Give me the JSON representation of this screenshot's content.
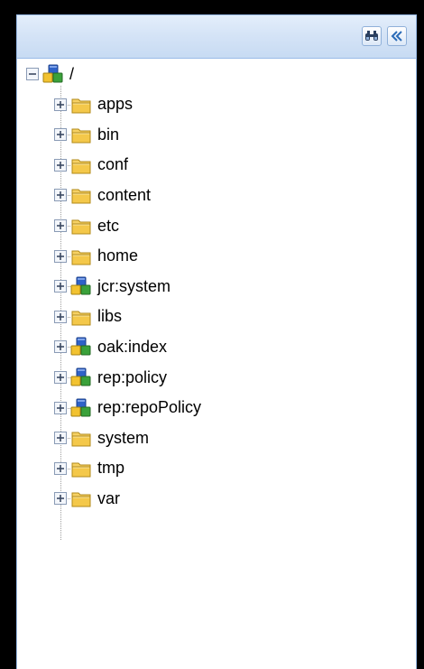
{
  "toolbar": {
    "search_icon": "binoculars-icon",
    "collapse_icon": "double-chevron-left-icon"
  },
  "tree": {
    "root": {
      "label": "/",
      "icon": "node-icon",
      "expanded": true
    },
    "children": [
      {
        "label": "apps",
        "icon": "folder-icon"
      },
      {
        "label": "bin",
        "icon": "folder-icon"
      },
      {
        "label": "conf",
        "icon": "folder-icon"
      },
      {
        "label": "content",
        "icon": "folder-icon"
      },
      {
        "label": "etc",
        "icon": "folder-icon"
      },
      {
        "label": "home",
        "icon": "folder-icon"
      },
      {
        "label": "jcr:system",
        "icon": "node-icon"
      },
      {
        "label": "libs",
        "icon": "folder-icon"
      },
      {
        "label": "oak:index",
        "icon": "node-icon"
      },
      {
        "label": "rep:policy",
        "icon": "node-icon"
      },
      {
        "label": "rep:repoPolicy",
        "icon": "node-icon"
      },
      {
        "label": "system",
        "icon": "folder-icon"
      },
      {
        "label": "tmp",
        "icon": "folder-icon"
      },
      {
        "label": "var",
        "icon": "folder-icon"
      }
    ]
  },
  "colors": {
    "header": "#d4e3f6",
    "border": "#99bbe8",
    "folder": "#f4c84a",
    "cube_blue": "#2e62c8",
    "cube_yellow": "#f2c230",
    "cube_green": "#3aa13a"
  }
}
